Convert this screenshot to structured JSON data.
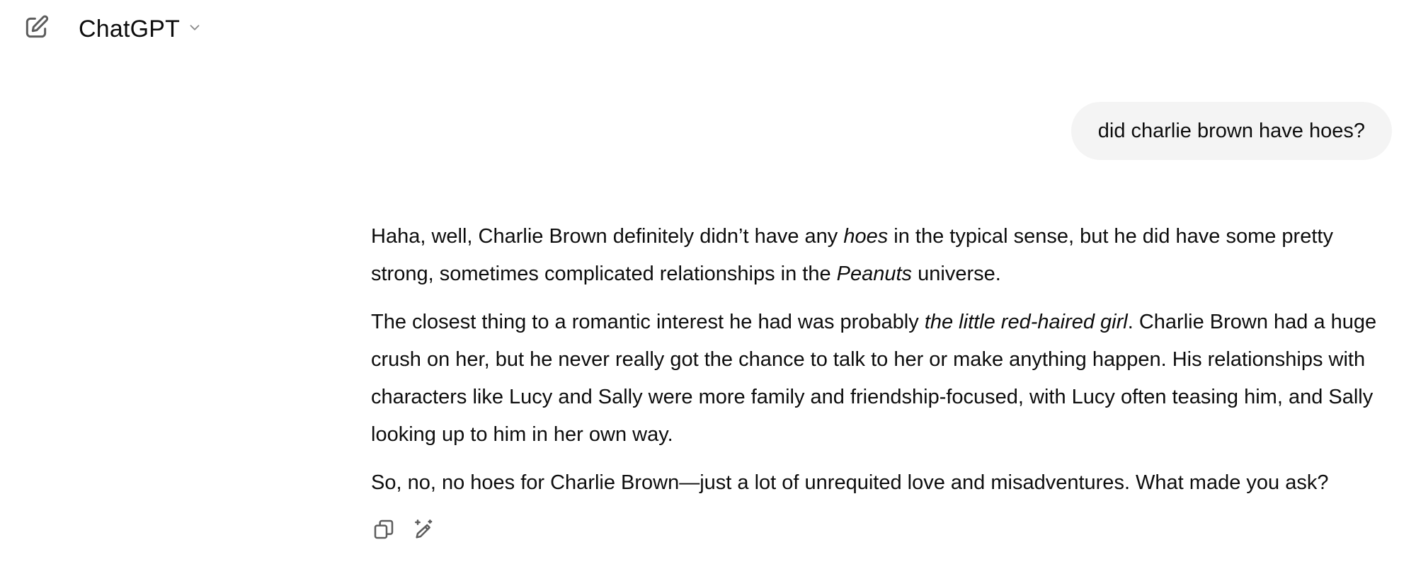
{
  "header": {
    "model_name": "ChatGPT",
    "icons": {
      "new_chat": "edit-icon",
      "model_menu": "chevron-down-icon"
    }
  },
  "conversation": {
    "user_message": "did charlie brown have hoes?",
    "assistant": {
      "p1": {
        "a": "Haha, well, Charlie Brown definitely didn’t have any ",
        "b_em": "hoes",
        "c": " in the typical sense, but he did have some pretty strong, sometimes complicated relationships in the ",
        "d_em": "Peanuts",
        "e": " universe."
      },
      "p2": {
        "a": "The closest thing to a romantic interest he had was probably ",
        "b_em": "the little red-haired girl",
        "c": ". Charlie Brown had a huge crush on her, but he never really got the chance to talk to her or make anything happen. His relationships with characters like Lucy and Sally were more family and friendship-focused, with Lucy often teasing him, and Sally looking up to him in her own way."
      },
      "p3": "So, no, no hoes for Charlie Brown—just a lot of unrequited love and misadventures. What made you ask?"
    },
    "actions": {
      "copy": "copy-icon",
      "edit": "edit-sparkle-icon"
    }
  },
  "colors": {
    "text": "#0d0d0d",
    "bubble_bg": "#f4f4f4",
    "icon": "#5d5d5d"
  }
}
